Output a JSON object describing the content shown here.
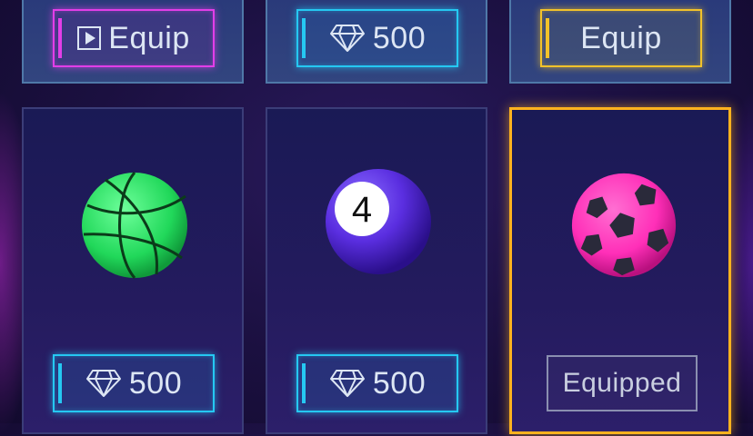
{
  "top_row": [
    {
      "button": {
        "label": "Equip",
        "icon": "play-video-icon",
        "style": "pink"
      }
    },
    {
      "button": {
        "label": "500",
        "icon": "diamond-icon",
        "style": "cyan"
      }
    },
    {
      "button": {
        "label": "Equip",
        "icon": null,
        "style": "gold"
      }
    }
  ],
  "items": [
    {
      "ball": "basketball",
      "ball_color": "#2ee86a",
      "button": {
        "label": "500",
        "icon": "diamond-icon",
        "style": "cyan"
      },
      "selected": false
    },
    {
      "ball": "billiard-ball",
      "ball_color": "#5a2ee0",
      "number": "4",
      "button": {
        "label": "500",
        "icon": "diamond-icon",
        "style": "cyan"
      },
      "selected": false
    },
    {
      "ball": "soccer-ball",
      "ball_color": "#ff2fb8",
      "button": {
        "label": "Equipped",
        "icon": null,
        "style": "gray"
      },
      "selected": true
    }
  ],
  "colors": {
    "cyan": "#25c8f2",
    "pink": "#e23ee8",
    "gold": "#f2c22a",
    "selected_border": "#ffb21e"
  }
}
